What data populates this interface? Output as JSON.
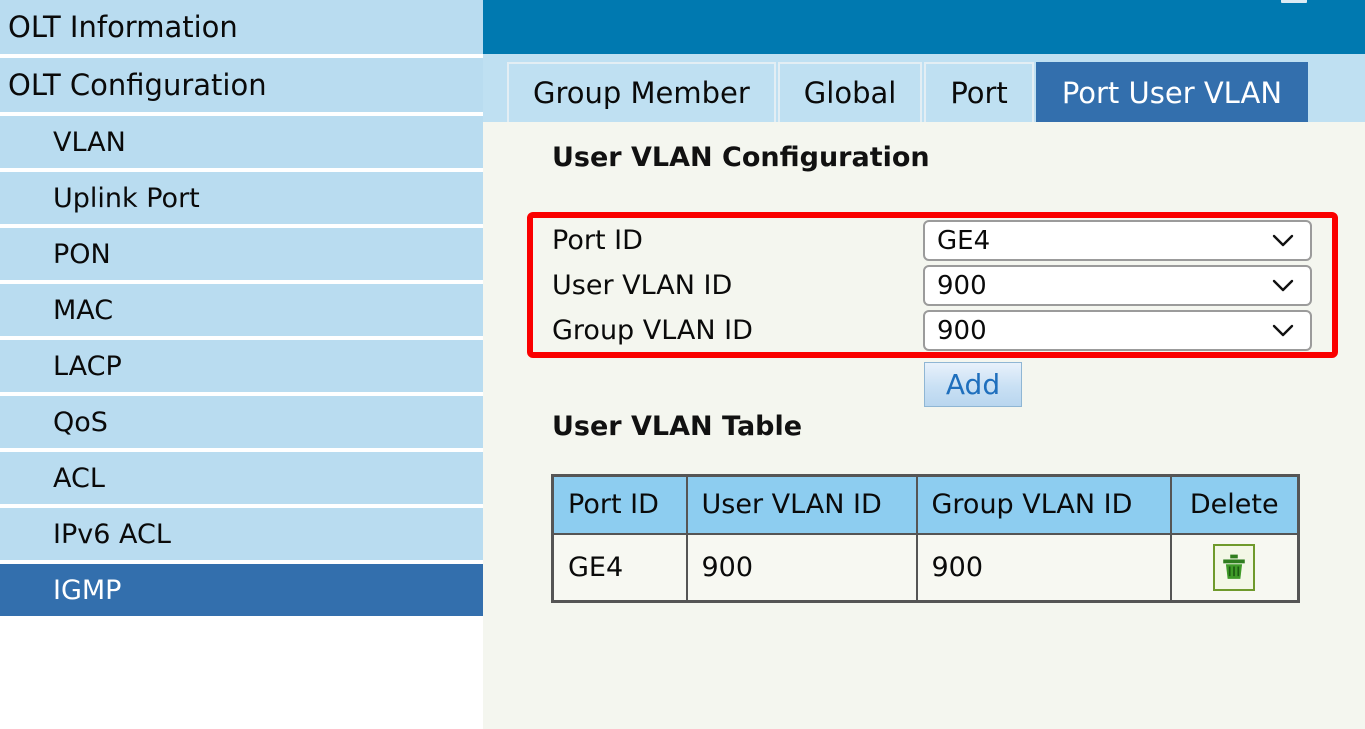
{
  "sidebar": {
    "banner_alt": "globe-network-banner",
    "items": [
      {
        "label": "OLT Information",
        "level": "top",
        "active": false
      },
      {
        "label": "OLT Configuration",
        "level": "top",
        "active": false
      },
      {
        "label": "VLAN",
        "level": "sub",
        "active": false
      },
      {
        "label": "Uplink Port",
        "level": "sub",
        "active": false
      },
      {
        "label": "PON",
        "level": "sub",
        "active": false
      },
      {
        "label": "MAC",
        "level": "sub",
        "active": false
      },
      {
        "label": "LACP",
        "level": "sub",
        "active": false
      },
      {
        "label": "QoS",
        "level": "sub",
        "active": false
      },
      {
        "label": "ACL",
        "level": "sub",
        "active": false
      },
      {
        "label": "IPv6 ACL",
        "level": "sub",
        "active": false
      },
      {
        "label": "IGMP",
        "level": "sub",
        "active": true
      }
    ]
  },
  "tabs": [
    {
      "label": "Group Member",
      "active": false
    },
    {
      "label": "Global",
      "active": false
    },
    {
      "label": "Port",
      "active": false
    },
    {
      "label": "Port User VLAN",
      "active": true
    }
  ],
  "main": {
    "config_title": "User VLAN Configuration",
    "table_title": "User VLAN Table",
    "add_label": "Add",
    "form": [
      {
        "label": "Port ID",
        "value": "GE4"
      },
      {
        "label": "User VLAN ID",
        "value": "900"
      },
      {
        "label": "Group VLAN ID",
        "value": "900"
      }
    ],
    "table": {
      "columns": [
        "Port ID",
        "User VLAN ID",
        "Group VLAN ID",
        "Delete"
      ],
      "rows": [
        {
          "port_id": "GE4",
          "user_vlan_id": "900",
          "group_vlan_id": "900",
          "delete_icon": "trash-icon"
        }
      ]
    }
  },
  "colors": {
    "topbar_blue": "#0079b0",
    "tabstrip_blue": "#bfe0f2",
    "active_blue": "#336fad",
    "sidebar_blue": "#b9dcf0",
    "content_bg": "#f4f6ef",
    "highlight_red": "#fa0000",
    "table_header_blue": "#8dcdf0",
    "add_text_blue": "#1f6fbd",
    "trash_green": "#2f7d1f"
  }
}
